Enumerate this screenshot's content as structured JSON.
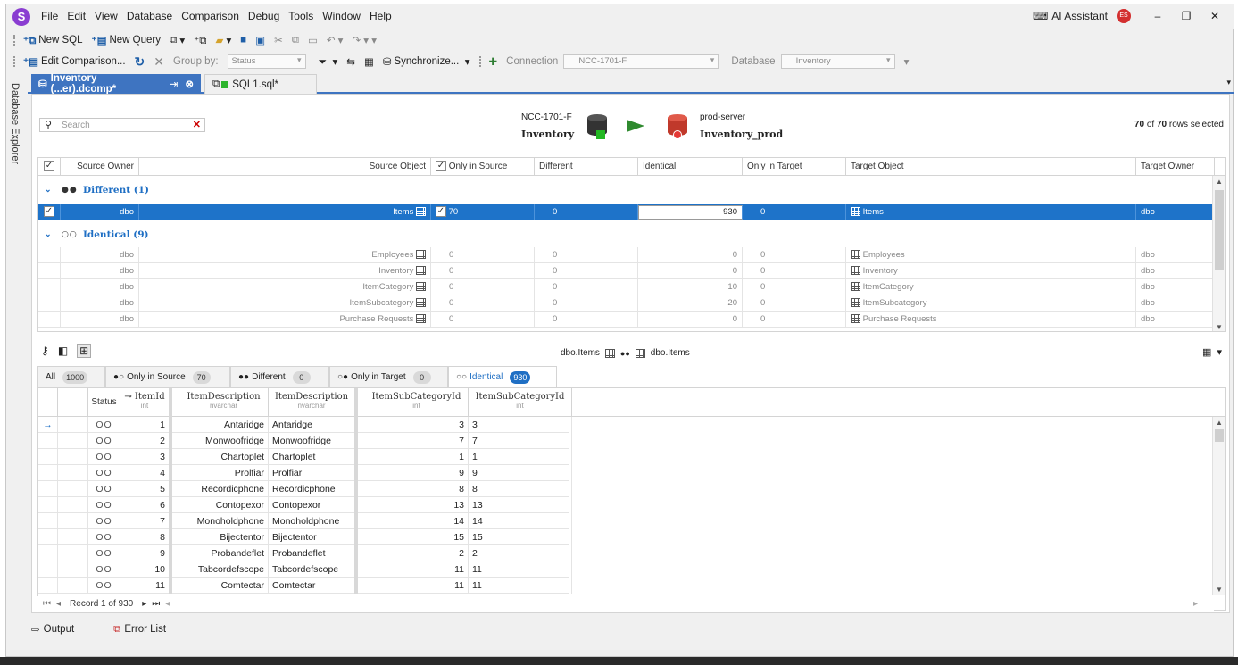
{
  "menu": {
    "items": [
      "File",
      "Edit",
      "View",
      "Database",
      "Comparison",
      "Debug",
      "Tools",
      "Window",
      "Help"
    ],
    "ai_assistant": "AI Assistant",
    "avatar_initials": "ES"
  },
  "toolbar1": {
    "new_sql": "New SQL",
    "new_query": "New Query"
  },
  "toolbar2": {
    "edit_comparison": "Edit Comparison...",
    "group_by_label": "Group by:",
    "group_by_value": "Status",
    "synchronize": "Synchronize...",
    "connection_label": "Connection",
    "connection_value": "NCC-1701-F",
    "database_label": "Database",
    "database_value": "Inventory"
  },
  "sidebar": {
    "label": "Database Explorer"
  },
  "tabs": [
    {
      "label": "Inventory (...er).dcomp*"
    },
    {
      "label": "SQL1.sql*"
    }
  ],
  "comparison": {
    "search_placeholder": "Search",
    "source_server": "NCC-1701-F",
    "source_db": "Inventory",
    "target_server": "prod-server",
    "target_db": "Inventory_prod",
    "rows_selected_count": "70",
    "rows_selected_of": "of",
    "rows_selected_total": "70",
    "rows_selected_suffix": "rows selected"
  },
  "grid_headers": {
    "source_owner": "Source Owner",
    "source_object": "Source Object",
    "only_in_source": "Only in Source",
    "different": "Different",
    "identical": "Identical",
    "only_in_target": "Only in Target",
    "target_object": "Target Object",
    "target_owner": "Target Owner"
  },
  "groups": {
    "different": "Different (1)",
    "identical": "Identical (9)"
  },
  "selected_row": {
    "source_owner": "dbo",
    "source_object": "Items",
    "only_in_source": "70",
    "different": "0",
    "identical": "930",
    "only_in_target": "0",
    "target_object": "Items",
    "target_owner": "dbo"
  },
  "identical_rows": [
    {
      "source_owner": "dbo",
      "source_object": "Employees",
      "only_in_source": "0",
      "different": "0",
      "identical": "0",
      "only_in_target": "0",
      "target_object": "Employees",
      "target_owner": "dbo"
    },
    {
      "source_owner": "dbo",
      "source_object": "Inventory",
      "only_in_source": "0",
      "different": "0",
      "identical": "0",
      "only_in_target": "0",
      "target_object": "Inventory",
      "target_owner": "dbo"
    },
    {
      "source_owner": "dbo",
      "source_object": "ItemCategory",
      "only_in_source": "0",
      "different": "0",
      "identical": "10",
      "only_in_target": "0",
      "target_object": "ItemCategory",
      "target_owner": "dbo"
    },
    {
      "source_owner": "dbo",
      "source_object": "ItemSubcategory",
      "only_in_source": "0",
      "different": "0",
      "identical": "20",
      "only_in_target": "0",
      "target_object": "ItemSubcategory",
      "target_owner": "dbo"
    },
    {
      "source_owner": "dbo",
      "source_object": "Purchase Requests",
      "only_in_source": "0",
      "different": "0",
      "identical": "0",
      "only_in_target": "0",
      "target_object": "Purchase Requests",
      "target_owner": "dbo"
    }
  ],
  "details": {
    "source_label": "dbo.Items",
    "target_label": "dbo.Items"
  },
  "filter_tabs": [
    {
      "label": "All",
      "count": "1000"
    },
    {
      "label": "Only in Source",
      "count": "70"
    },
    {
      "label": "Different",
      "count": "0"
    },
    {
      "label": "Only in Target",
      "count": "0"
    },
    {
      "label": "Identical",
      "count": "930"
    }
  ],
  "data_headers": {
    "status": "Status",
    "item_id": "ItemId",
    "item_id_type": "int",
    "desc_src": "ItemDescription",
    "desc_src_type": "nvarchar",
    "desc_tgt": "ItemDescription",
    "desc_tgt_type": "nvarchar",
    "sub_src": "ItemSubCategoryId",
    "sub_src_type": "int",
    "sub_tgt": "ItemSubCategoryId",
    "sub_tgt_type": "int"
  },
  "data_rows": [
    {
      "status": "OO",
      "id": "1",
      "desc_src": "Antaridge",
      "desc_tgt": "Antaridge",
      "sub_src": "3",
      "sub_tgt": "3"
    },
    {
      "status": "OO",
      "id": "2",
      "desc_src": "Monwoofridge",
      "desc_tgt": "Monwoofridge",
      "sub_src": "7",
      "sub_tgt": "7"
    },
    {
      "status": "OO",
      "id": "3",
      "desc_src": "Chartoplet",
      "desc_tgt": "Chartoplet",
      "sub_src": "1",
      "sub_tgt": "1"
    },
    {
      "status": "OO",
      "id": "4",
      "desc_src": "Prolfiar",
      "desc_tgt": "Prolfiar",
      "sub_src": "9",
      "sub_tgt": "9"
    },
    {
      "status": "OO",
      "id": "5",
      "desc_src": "Recordicphone",
      "desc_tgt": "Recordicphone",
      "sub_src": "8",
      "sub_tgt": "8"
    },
    {
      "status": "OO",
      "id": "6",
      "desc_src": "Contopexor",
      "desc_tgt": "Contopexor",
      "sub_src": "13",
      "sub_tgt": "13"
    },
    {
      "status": "OO",
      "id": "7",
      "desc_src": "Monoholdphone",
      "desc_tgt": "Monoholdphone",
      "sub_src": "14",
      "sub_tgt": "14"
    },
    {
      "status": "OO",
      "id": "8",
      "desc_src": "Bijectentor",
      "desc_tgt": "Bijectentor",
      "sub_src": "15",
      "sub_tgt": "15"
    },
    {
      "status": "OO",
      "id": "9",
      "desc_src": "Probandeflet",
      "desc_tgt": "Probandeflet",
      "sub_src": "2",
      "sub_tgt": "2"
    },
    {
      "status": "OO",
      "id": "10",
      "desc_src": "Tabcordefscope",
      "desc_tgt": "Tabcordefscope",
      "sub_src": "11",
      "sub_tgt": "11"
    },
    {
      "status": "OO",
      "id": "11",
      "desc_src": "Comtectar",
      "desc_tgt": "Comtectar",
      "sub_src": "11",
      "sub_tgt": "11"
    }
  ],
  "navigator": {
    "record_text": "Record 1 of 930"
  },
  "bottom": {
    "output": "Output",
    "error_list": "Error List"
  }
}
